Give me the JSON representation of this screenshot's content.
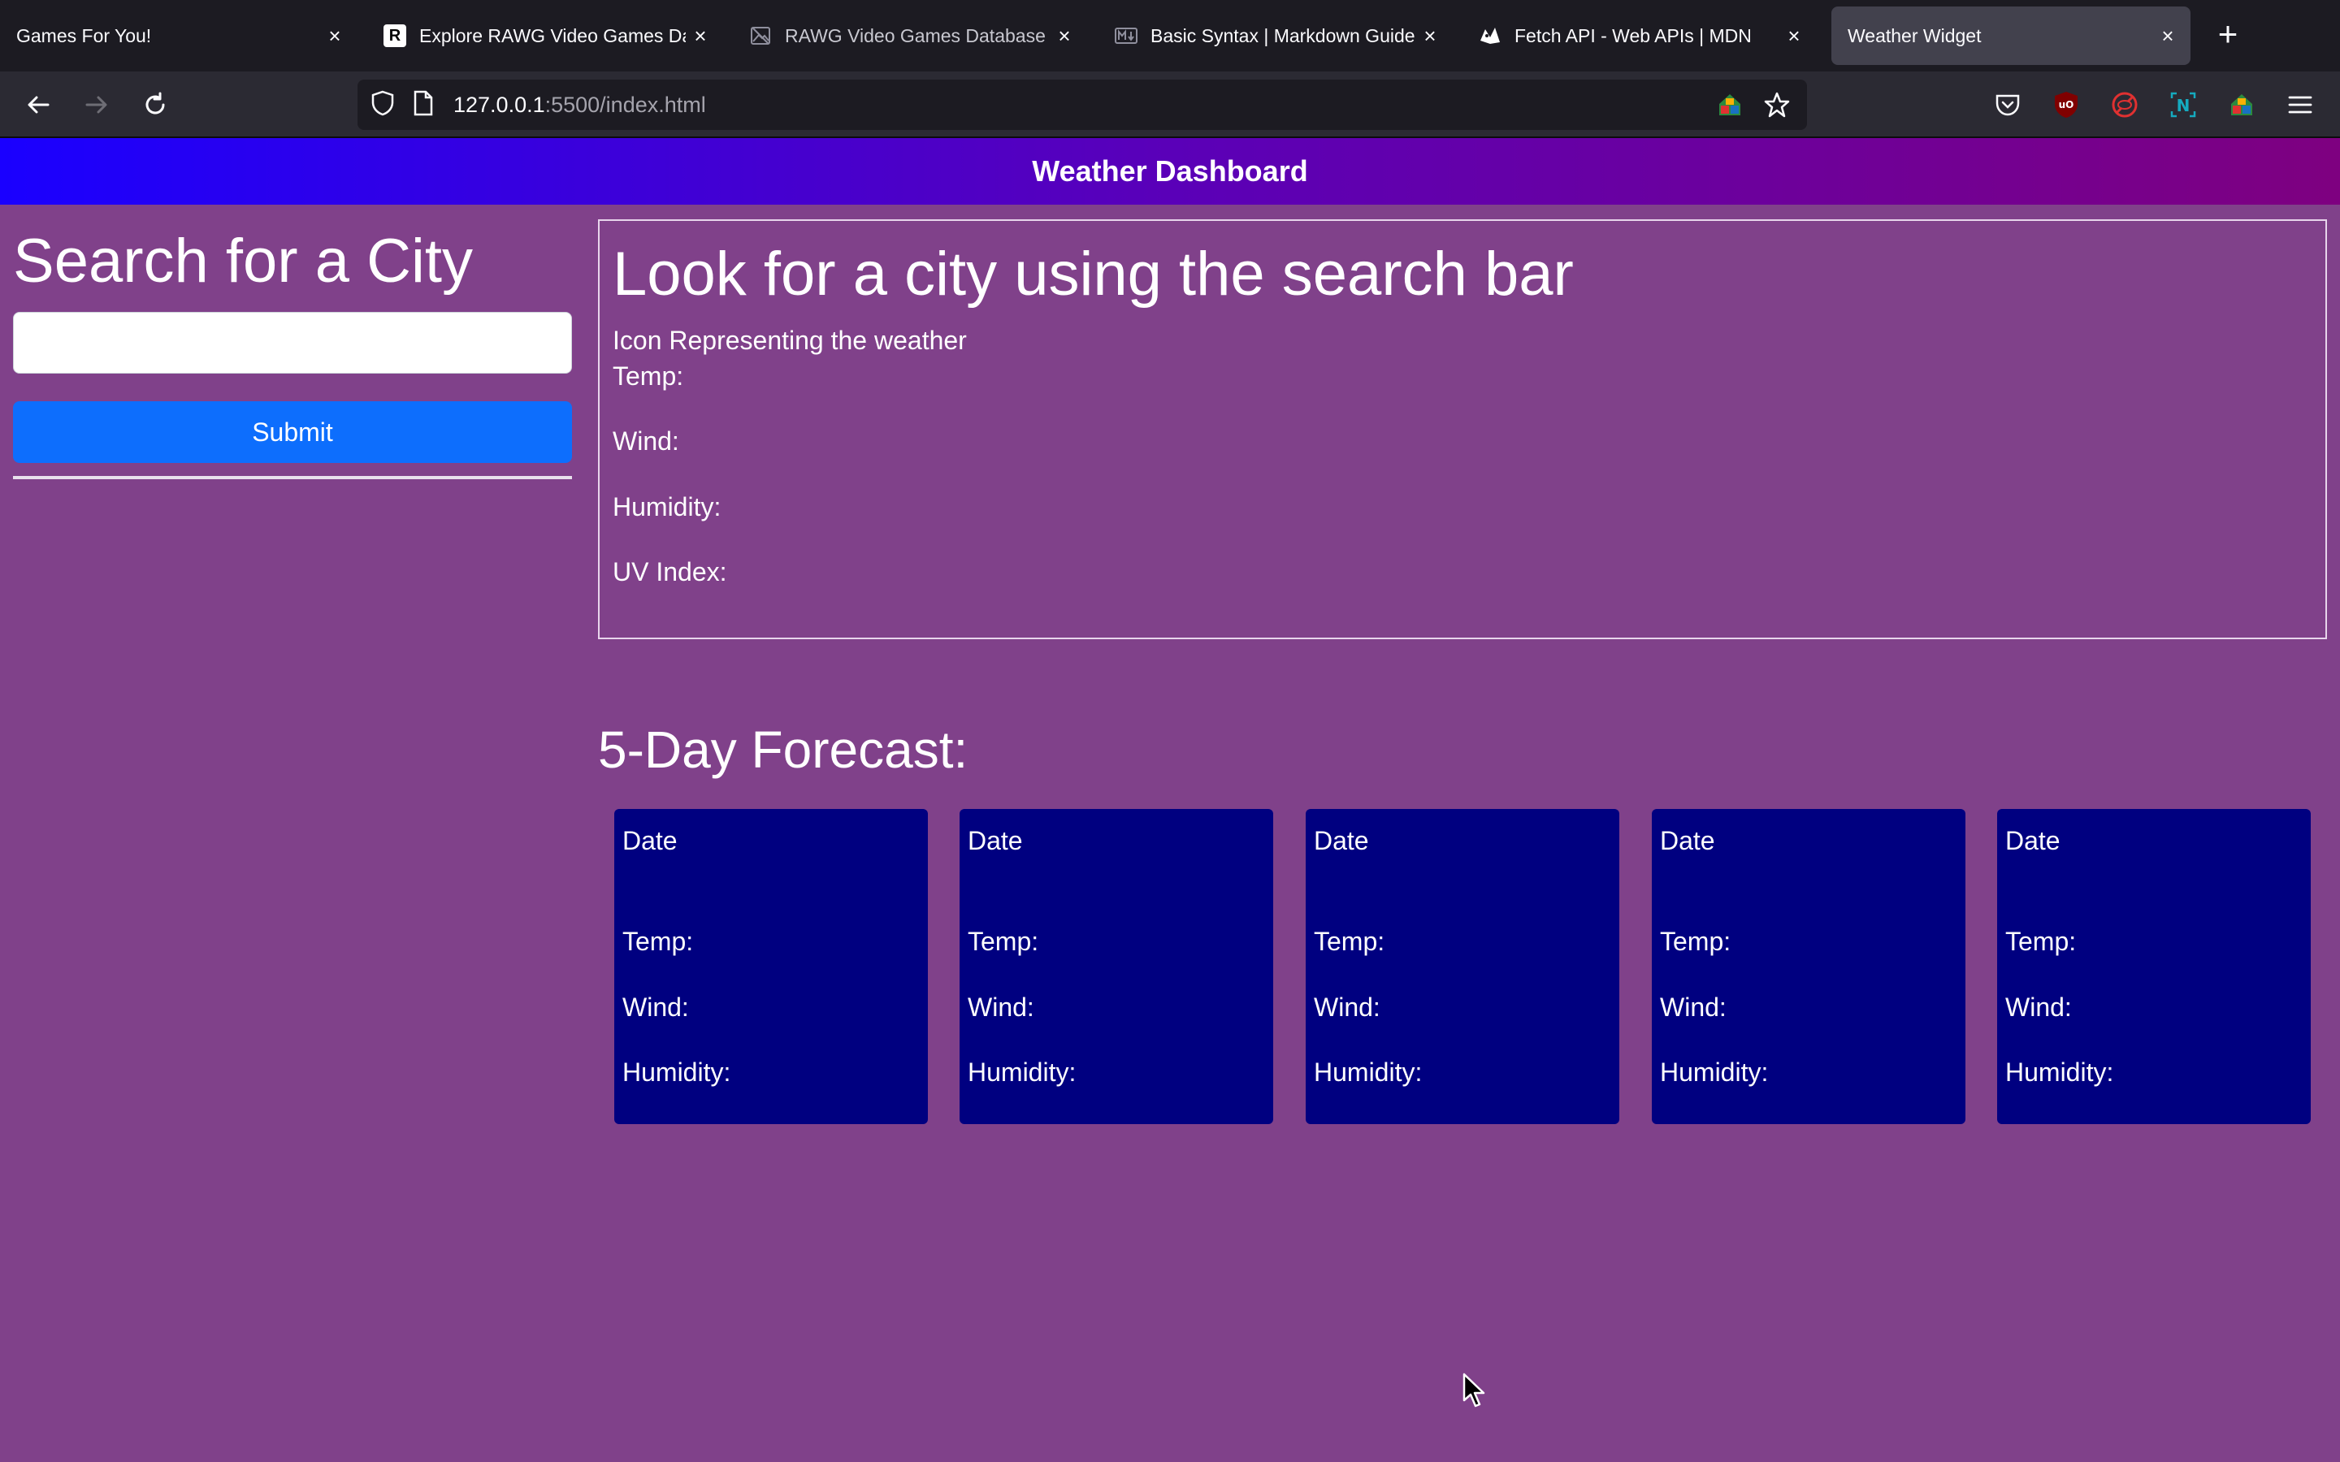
{
  "browser": {
    "tabs": [
      {
        "title": "Games For You!",
        "favicon": "none",
        "active": false
      },
      {
        "title": "Explore RAWG Video Games Dat",
        "favicon": "rawg-logo",
        "active": false
      },
      {
        "title": "RAWG Video Games Database A",
        "favicon": "broken-image",
        "active": false
      },
      {
        "title": "Basic Syntax | Markdown Guide",
        "favicon": "markdown-logo",
        "active": false
      },
      {
        "title": "Fetch API - Web APIs | MDN",
        "favicon": "mdn-logo",
        "active": false
      },
      {
        "title": "Weather Widget",
        "favicon": "none",
        "active": true
      }
    ],
    "rawg_letter": "R",
    "address": {
      "host": "127.0.0.1",
      "path": ":5500/index.html"
    }
  },
  "page": {
    "header_title": "Weather Dashboard",
    "search": {
      "title": "Search for a City",
      "input_value": "",
      "submit_label": "Submit"
    },
    "current": {
      "title": "Look for a city using the search bar",
      "icon_text": "Icon Representing the weather",
      "temp_label": "Temp:",
      "wind_label": "Wind:",
      "humidity_label": "Humidity:",
      "uv_label": "UV Index:"
    },
    "forecast": {
      "title": "5-Day Forecast:",
      "cards": [
        {
          "date": "Date",
          "temp": "Temp:",
          "wind": "Wind:",
          "humidity": "Humidity:"
        },
        {
          "date": "Date",
          "temp": "Temp:",
          "wind": "Wind:",
          "humidity": "Humidity:"
        },
        {
          "date": "Date",
          "temp": "Temp:",
          "wind": "Wind:",
          "humidity": "Humidity:"
        },
        {
          "date": "Date",
          "temp": "Temp:",
          "wind": "Wind:",
          "humidity": "Humidity:"
        },
        {
          "date": "Date",
          "temp": "Temp:",
          "wind": "Wind:",
          "humidity": "Humidity:"
        }
      ]
    }
  },
  "colors": {
    "page_background": "#80418a",
    "header_gradient_start": "#1a00ff",
    "header_gradient_end": "#7e0080",
    "submit_button": "#0d6efd",
    "forecast_card": "#000080"
  }
}
